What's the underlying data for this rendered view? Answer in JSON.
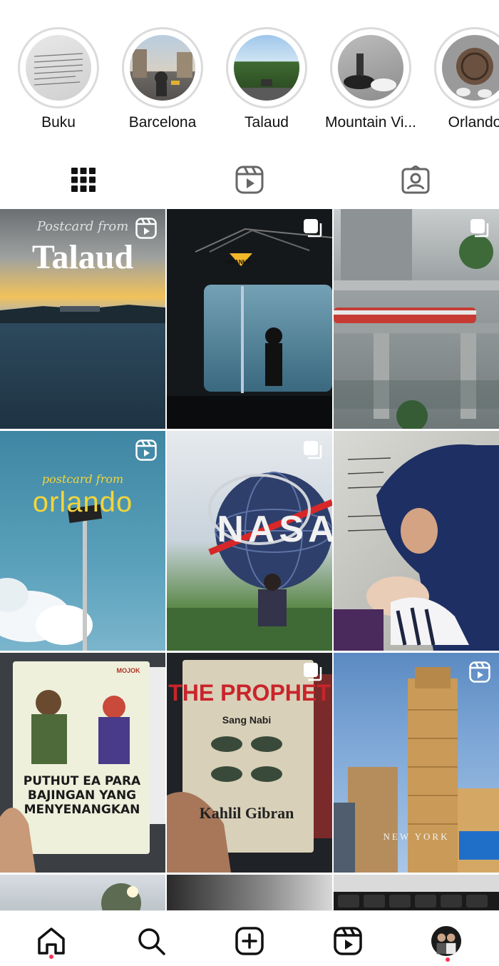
{
  "highlights": [
    {
      "label": "Buku"
    },
    {
      "label": "Barcelona"
    },
    {
      "label": "Talaud"
    },
    {
      "label": "Mountain Vi..."
    },
    {
      "label": "Orlando"
    }
  ],
  "tabs": [
    {
      "icon": "grid-icon"
    },
    {
      "icon": "reels-icon"
    },
    {
      "icon": "tagged-icon"
    }
  ],
  "posts": [
    {
      "name": "post-talaud",
      "type": "reel",
      "overlay_small": "Postcard from",
      "overlay_big": "Talaud"
    },
    {
      "name": "post-aquarium",
      "type": "carousel",
      "sign": "PIRANHA"
    },
    {
      "name": "post-train",
      "type": "carousel"
    },
    {
      "name": "post-orlando",
      "type": "reel",
      "overlay_small": "postcard from",
      "overlay_big": "orlando"
    },
    {
      "name": "post-nasa",
      "type": "carousel",
      "sign": "NASA"
    },
    {
      "name": "post-mother-baby",
      "type": "none"
    },
    {
      "name": "post-book-mojok",
      "type": "none",
      "brand": "MOJOK",
      "book_title": "PUTHUT EA PARA BAJINGAN YANG MENYENANGKAN"
    },
    {
      "name": "post-book-prophet",
      "type": "carousel",
      "book_title": "THE PROPHET",
      "book_subtitle": "Sang Nabi",
      "author": "Kahlil Gibran"
    },
    {
      "name": "post-newyork",
      "type": "reel",
      "caption": "NEW YORK"
    }
  ],
  "nav": [
    {
      "icon": "home-icon"
    },
    {
      "icon": "search-icon"
    },
    {
      "icon": "create-icon"
    },
    {
      "icon": "reels-icon"
    },
    {
      "icon": "profile-avatar"
    }
  ],
  "colors": {
    "accent_dot": "#ff2e52",
    "ring": "#dbdbdb"
  }
}
